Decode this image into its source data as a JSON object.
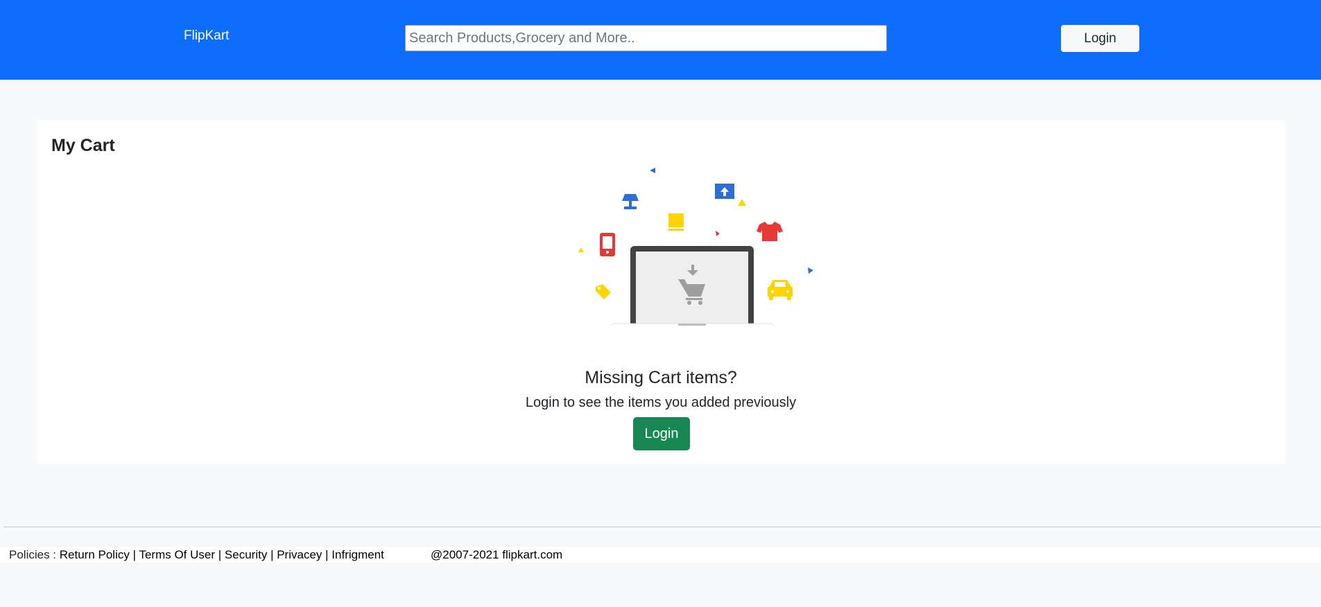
{
  "header": {
    "brand": "FlipKart",
    "search_placeholder": "Search Products,Grocery and More..",
    "search_value": "",
    "login_label": "Login",
    "bg_color": "#0d6efd"
  },
  "cart": {
    "title": "My Cart",
    "illustration_icon": "empty-cart-laptop-illustration",
    "missing_title": "Missing Cart items?",
    "missing_subtitle": "Login to see the items you added previously",
    "login_label": "Login",
    "login_color": "#198754"
  },
  "footer": {
    "policies_label": "Policies :",
    "links": [
      "Return Policy",
      "Terms Of User",
      "Security",
      "Privacey",
      "Infrigment"
    ],
    "separator": "|",
    "copyright": "@2007-2021 flipkart.com"
  }
}
